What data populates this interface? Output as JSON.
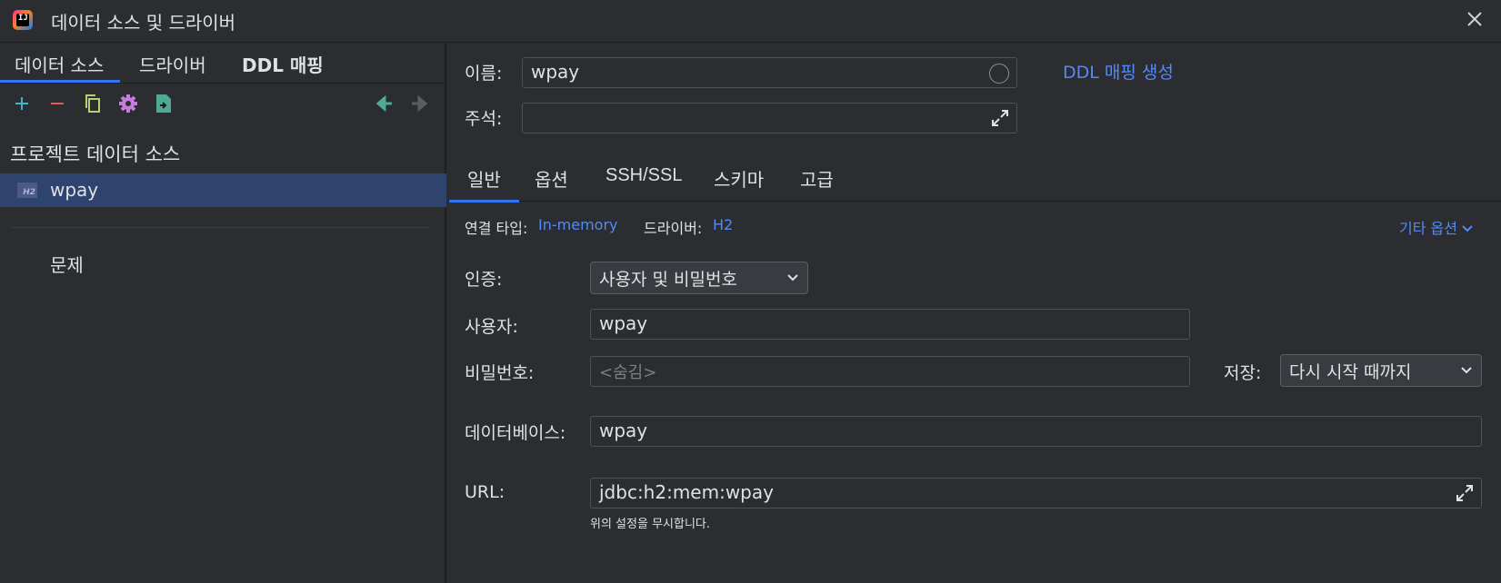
{
  "window": {
    "title": "데이터 소스 및 드라이버",
    "app_icon_text": "IJ"
  },
  "left": {
    "tabs": [
      "데이터 소스",
      "드라이버",
      "DDL 매핑"
    ],
    "active_tab": "데이터 소스",
    "toolbar": {
      "icons": [
        "add-icon",
        "remove-icon",
        "copy-icon",
        "gear-icon",
        "export-icon",
        "back-arrow-icon",
        "forward-arrow-icon"
      ]
    },
    "section_title": "프로젝트 데이터 소스",
    "data_sources": [
      {
        "name": "wpay",
        "icon": "h2-icon",
        "icon_text": "H2",
        "selected": true
      }
    ],
    "problems_label": "문제"
  },
  "form": {
    "name_label": "이름:",
    "name_value": "wpay",
    "ddl_link": "DDL 매핑 생성",
    "comment_label": "주석:",
    "comment_value": ""
  },
  "main_tabs": [
    "일반",
    "옵션",
    "SSH/SSL",
    "스키마",
    "고급"
  ],
  "active_main_tab": "일반",
  "general": {
    "conn_type_label": "연결 타입:",
    "conn_type_value": "In-memory",
    "driver_label": "드라이버:",
    "driver_value": "H2",
    "more_options": "기타 옵션",
    "auth_label": "인증:",
    "auth_value": "사용자 및 비밀번호",
    "user_label": "사용자:",
    "user_value": "wpay",
    "password_label": "비밀번호:",
    "password_placeholder": "<숨김>",
    "save_label": "저장:",
    "save_value": "다시 시작 때까지",
    "database_label": "데이터베이스:",
    "database_value": "wpay",
    "url_label": "URL:",
    "url_value": "jdbc:h2:mem:wpay",
    "url_hint": "위의 설정을 무시합니다."
  },
  "colors": {
    "background": "#2b2d30",
    "accent": "#3574f0",
    "link": "#548af7",
    "selection": "#2e436e"
  }
}
